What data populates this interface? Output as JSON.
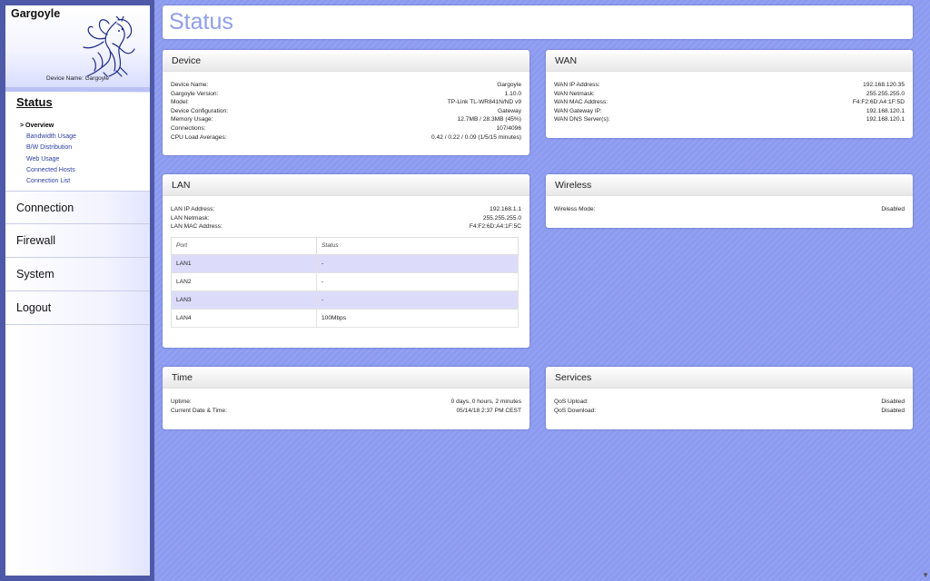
{
  "brand": {
    "title": "Gargoyle",
    "device_name_label": "Device Name: Gargoyle"
  },
  "sidebar": {
    "active_section": "Status",
    "sub_items": [
      {
        "label": "> Overview",
        "active": true
      },
      {
        "label": "Bandwidth Usage",
        "active": false
      },
      {
        "label": "B/W Distribution",
        "active": false
      },
      {
        "label": "Web Usage",
        "active": false
      },
      {
        "label": "Connected Hosts",
        "active": false
      },
      {
        "label": "Connection List",
        "active": false
      }
    ],
    "sections": [
      "Connection",
      "Firewall",
      "System",
      "Logout"
    ]
  },
  "page_title": "Status",
  "device": {
    "title": "Device",
    "rows": [
      {
        "k": "Device Name:",
        "v": "Gargoyle"
      },
      {
        "k": "Gargoyle Version:",
        "v": "1.10.0"
      },
      {
        "k": "Model:",
        "v": "TP-Link TL-WR841N/ND v9"
      },
      {
        "k": "Device Configuration:",
        "v": "Gateway"
      },
      {
        "k": "Memory Usage:",
        "v": "12.7MB / 28.3MB (45%)"
      },
      {
        "k": "Connections:",
        "v": "107/4096"
      },
      {
        "k": "CPU Load Averages:",
        "v": "0.42 / 0.22 / 0.09  (1/5/15 minutes)"
      }
    ]
  },
  "wan": {
    "title": "WAN",
    "rows": [
      {
        "k": "WAN IP Address:",
        "v": "192.168.120.35"
      },
      {
        "k": "WAN Netmask:",
        "v": "255.255.255.0"
      },
      {
        "k": "WAN MAC Address:",
        "v": "F4:F2:6D:A4:1F:5D"
      },
      {
        "k": "WAN Gateway IP:",
        "v": "192.168.120.1"
      },
      {
        "k": "WAN DNS Server(s):",
        "v": "192.168.120.1"
      }
    ]
  },
  "lan": {
    "title": "LAN",
    "rows": [
      {
        "k": "LAN IP Address:",
        "v": "192.168.1.1"
      },
      {
        "k": "LAN Netmask:",
        "v": "255.255.255.0"
      },
      {
        "k": "LAN MAC Address:",
        "v": "F4:F2:6D:A4:1F:5C"
      }
    ],
    "port_table": {
      "headers": [
        "Port",
        "Status"
      ],
      "rows": [
        [
          "LAN1",
          "-"
        ],
        [
          "LAN2",
          "-"
        ],
        [
          "LAN3",
          "-"
        ],
        [
          "LAN4",
          "100Mbps"
        ]
      ]
    }
  },
  "wireless": {
    "title": "Wireless",
    "rows": [
      {
        "k": "Wireless Mode:",
        "v": "Disabled"
      }
    ]
  },
  "time": {
    "title": "Time",
    "rows": [
      {
        "k": "Uptime:",
        "v": "0 days, 0 hours, 2 minutes"
      },
      {
        "k": "Current Date & Time:",
        "v": "05/14/18 2:37 PM CEST"
      }
    ]
  },
  "services": {
    "title": "Services",
    "rows": [
      {
        "k": "QoS Upload:",
        "v": "Disabled"
      },
      {
        "k": "QoS Download:",
        "v": "Disabled"
      }
    ]
  },
  "colors": {
    "background": "#8c9bf0",
    "sidebar_frame": "#4e5aa8",
    "title_accent": "#8f9ee8",
    "table_stripe": "#dcdcfa"
  }
}
